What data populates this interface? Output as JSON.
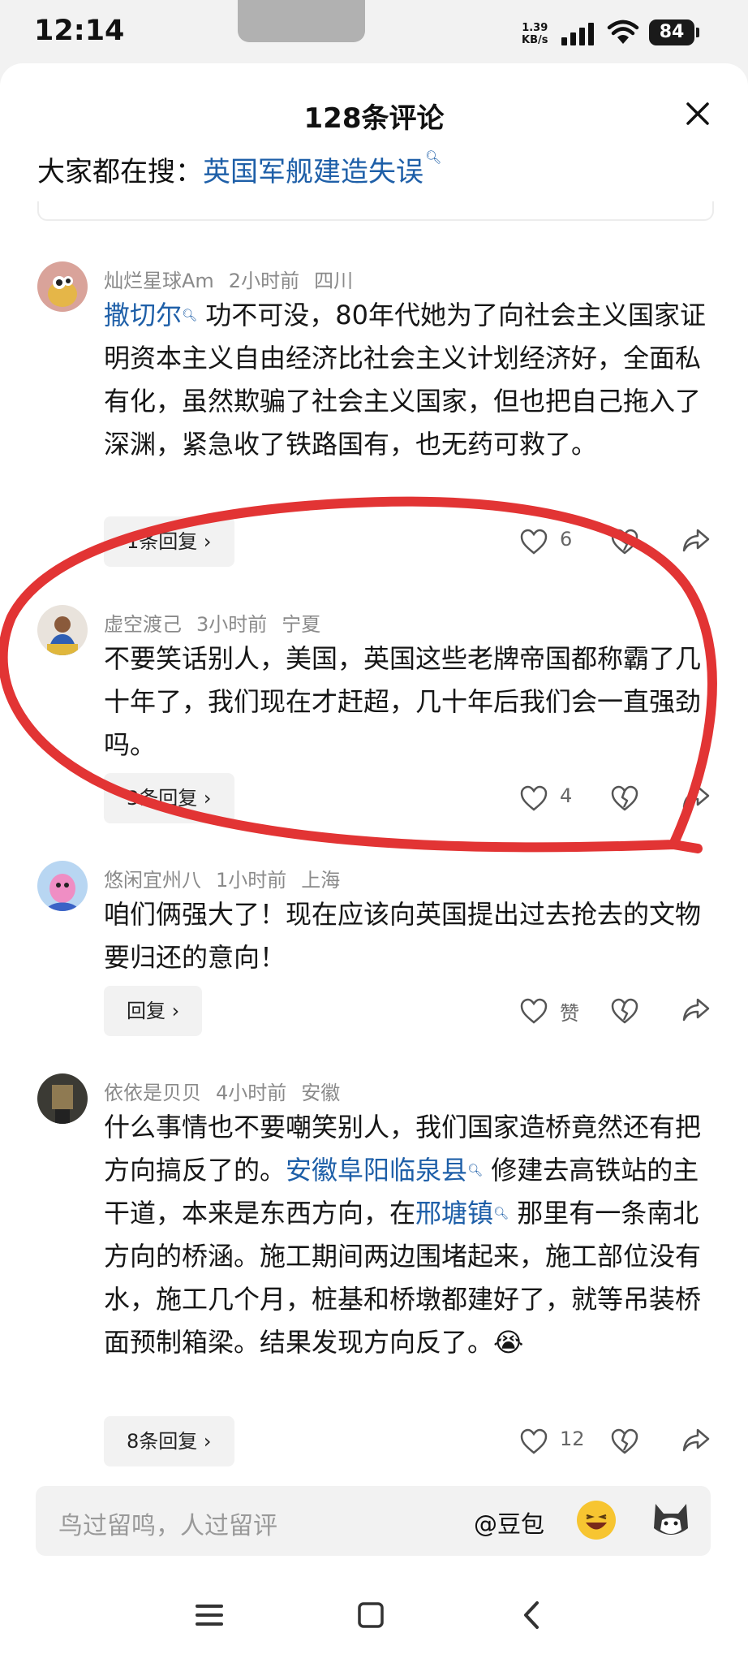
{
  "status": {
    "time": "12:14",
    "speed_value": "1.39",
    "speed_unit": "KB/s",
    "battery": "84"
  },
  "sheet": {
    "title": "128条评论",
    "search_prefix": "大家都在搜：",
    "search_term": "英国军舰建造失误"
  },
  "comments": [
    {
      "user": "灿烂星球Am",
      "time": "2小时前",
      "location": "四川",
      "link": "撒切尔",
      "text": "功不可没，80年代她为了向社会主义国家证明资本主义自由经济比社会主义计划经济好，全面私有化，虽然欺骗了社会主义国家，但也把自己拖入了深渊，紧急收了铁路国有，也无药可救了。",
      "reply": "1条回复 ›",
      "likes": "6"
    },
    {
      "user": "虚空渡己",
      "time": "3小时前",
      "location": "宁夏",
      "text": "不要笑话别人，美国，英国这些老牌帝国都称霸了几十年了，我们现在才赶超，几十年后我们会一直强劲吗。",
      "reply": "3条回复 ›",
      "likes": "4"
    },
    {
      "user": "悠闲宜州八",
      "time": "1小时前",
      "location": "上海",
      "text": "咱们俩强大了！现在应该向英国提出过去抢去的文物要归还的意向！",
      "reply": "回复 ›",
      "likes": "赞"
    },
    {
      "user": "依依是贝贝",
      "time": "4小时前",
      "location": "安徽",
      "text_a": "什么事情也不要嘲笑别人，我们国家造桥竟然还有把方向搞反了的。",
      "link_a": "安徽阜阳临泉县",
      "text_b": "修建去高铁站的主干道，本来是东西方向，在",
      "link_b": "邢塘镇",
      "text_c": "那里有一条南北方向的桥涵。施工期间两边围堵起来，施工部位没有水，施工几个月，桩基和桥墩都建好了，就等吊装桥面预制箱梁。结果发现方向反了。",
      "emoji": "😭",
      "reply": "8条回复 ›",
      "likes": "12"
    }
  ],
  "input": {
    "placeholder": "鸟过留鸣，人过留评",
    "at_label": "@豆包"
  },
  "colors": {
    "link": "#1e5fa8",
    "annotation": "#e23434"
  }
}
